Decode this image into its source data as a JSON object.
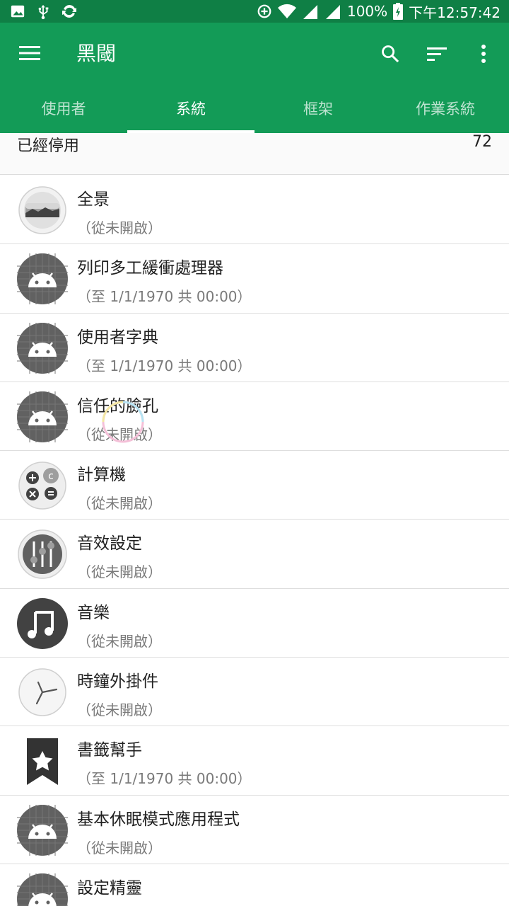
{
  "status_bar": {
    "battery": "100%",
    "time": "下午12:57:42",
    "icons_left": [
      "image-icon",
      "usb-icon",
      "sync-icon"
    ],
    "icons_right": [
      "data-saver-icon",
      "wifi-icon",
      "signal-icon",
      "signal-icon-2",
      "battery-icon"
    ]
  },
  "appbar": {
    "title": "黑閾",
    "color": "#139b57",
    "status_color": "#0f7f45",
    "actions": [
      "search-icon",
      "sort-icon",
      "more-vert-icon"
    ]
  },
  "tabs": [
    {
      "label": "使用者",
      "active": false
    },
    {
      "label": "系統",
      "active": true
    },
    {
      "label": "框架",
      "active": false
    },
    {
      "label": "作業系統",
      "active": false
    }
  ],
  "section": {
    "label": "已經停用",
    "count": "72"
  },
  "apps": [
    {
      "name": "全景",
      "status": "（從未開啟）",
      "icon": "panorama-icon"
    },
    {
      "name": "列印多工緩衝處理器",
      "status": "（至 1/1/1970 共 00:00）",
      "icon": "android-icon"
    },
    {
      "name": "使用者字典",
      "status": "（至 1/1/1970 共 00:00）",
      "icon": "android-icon"
    },
    {
      "name": "信任的臉孔",
      "status": "（從未開啟）",
      "icon": "android-icon"
    },
    {
      "name": "計算機",
      "status": "（從未開啟）",
      "icon": "calculator-icon"
    },
    {
      "name": "音效設定",
      "status": "（從未開啟）",
      "icon": "equalizer-icon"
    },
    {
      "name": "音樂",
      "status": "（從未開啟）",
      "icon": "music-icon"
    },
    {
      "name": "時鐘外掛件",
      "status": "（從未開啟）",
      "icon": "clock-icon"
    },
    {
      "name": "書籤幫手",
      "status": "（至 1/1/1970 共 00:00）",
      "icon": "bookmark-icon"
    },
    {
      "name": "基本休眠模式應用程式",
      "status": "（從未開啟）",
      "icon": "android-icon"
    },
    {
      "name": "設定精靈",
      "status": "",
      "icon": "android-icon"
    }
  ]
}
